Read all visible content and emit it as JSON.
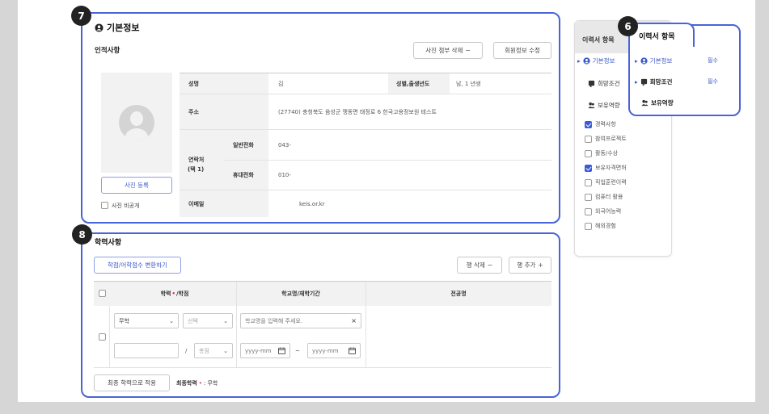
{
  "section7": {
    "badge": "7",
    "title": "기본정보",
    "subtitle": "인적사항",
    "photo_delete_btn": "사진 첨부 삭제",
    "edit_btn": "회원정보 수정",
    "photo_register_btn": "사진 등록",
    "photo_private_label": "사진 비공개",
    "rows": {
      "name_label": "성명",
      "name_value": "김",
      "gender_label": "성별,출생년도",
      "gender_value": "남, 1    년생",
      "address_label": "주소",
      "address_value": "(27740) 충청북도 음성군 맹동면 태정로 6 한국고용정보원 테스트",
      "contact_label": "연락처",
      "contact_sub": "(택 1)",
      "phone_label": "일반전화",
      "phone_value": "043-",
      "mobile_label": "휴대전화",
      "mobile_value": "010-",
      "email_label": "이메일",
      "email_value": "keis.or.kr"
    }
  },
  "section8": {
    "badge": "8",
    "title": "학력사항",
    "convert_btn": "학점/어학점수 변환하기",
    "row_delete_btn": "행 삭제",
    "row_add_btn": "행 추가",
    "headers": {
      "degree": "학력",
      "degree_suffix": "/학점",
      "school": "학교명/재학기간",
      "major": "전공명"
    },
    "degree_select": "무학",
    "type_select": "선택",
    "school_placeholder": "학교명을 입력해 주세요.",
    "score_select": "총점",
    "date_from": "yyyy-mm",
    "date_to": "yyyy-mm",
    "slash": "/",
    "tilde": "~",
    "apply_btn": "최종 학력으로 적용",
    "final_label": "최종학력",
    "final_value": ": 무학"
  },
  "nav": {
    "header": "이력서 항목",
    "items": [
      "기본정보",
      "희망조건",
      "보유역량"
    ],
    "checks": [
      {
        "label": "경력사항",
        "checked": true
      },
      {
        "label": "참여프로젝트",
        "checked": false
      },
      {
        "label": "활동/수상",
        "checked": false
      },
      {
        "label": "보유자격면허",
        "checked": true
      },
      {
        "label": "직업훈련이력",
        "checked": false
      },
      {
        "label": "컴퓨터 활용",
        "checked": false
      },
      {
        "label": "외국어능력",
        "checked": false
      },
      {
        "label": "해외경험",
        "checked": false
      }
    ]
  },
  "popup": {
    "badge": "6",
    "title": "이력서 항목",
    "items": [
      {
        "label": "기본정보",
        "tag": "필수"
      },
      {
        "label": "희망조건",
        "tag": "필수"
      },
      {
        "label": "보유역량",
        "tag": ""
      }
    ]
  },
  "colors": {
    "accent": "#4b63d8",
    "required": "#e0334d",
    "checked": "#3a5ad8"
  }
}
